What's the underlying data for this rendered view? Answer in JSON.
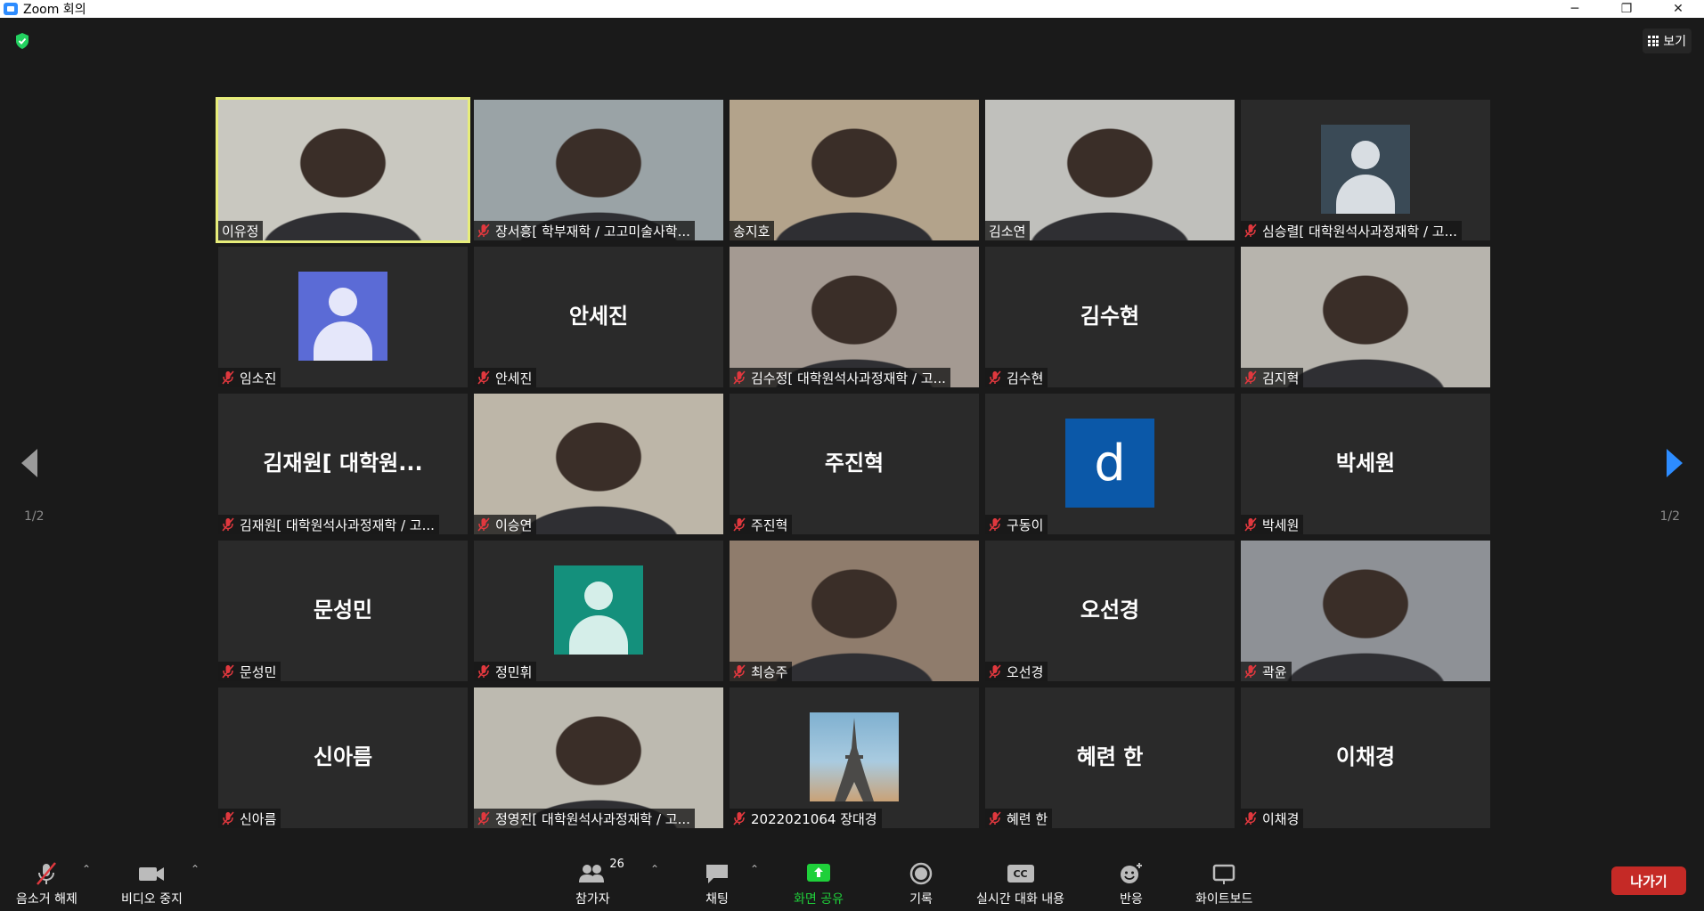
{
  "window": {
    "title": "Zoom 회의",
    "minimize": "─",
    "restore": "❐",
    "close": "✕"
  },
  "header": {
    "view_label": "보기"
  },
  "pagination": {
    "left": "1/2",
    "right": "1/2"
  },
  "colors": {
    "active_border": "#e7ed7a",
    "share_green": "#1fd03a",
    "leave_red": "#c52a26",
    "mute_red": "#e0383e"
  },
  "tiles": [
    {
      "name": "이유정",
      "kind": "video",
      "muted": false,
      "active": true,
      "bg": "#c9c8c0"
    },
    {
      "name": "장서흥[ 학부재학 / 고고미술사학...",
      "kind": "video",
      "muted": true,
      "bg": "#9aa3a6"
    },
    {
      "name": "송지호",
      "kind": "video",
      "muted": false,
      "bg": "#b3a38b"
    },
    {
      "name": "김소연",
      "kind": "video",
      "muted": false,
      "bg": "#c0c0bc"
    },
    {
      "name": "심승렬[ 대학원석사과정재학 / 고...",
      "kind": "avatar",
      "muted": true,
      "avatar_bg": "#3a4a56",
      "avatar_fg": "#d8dde2"
    },
    {
      "name": "임소진",
      "kind": "avatar",
      "muted": true,
      "avatar_bg": "#5b6bd6",
      "avatar_fg": "#e5e7fa"
    },
    {
      "name": "안세진",
      "kind": "text",
      "muted": true,
      "big": "안세진"
    },
    {
      "name": "김수정[ 대학원석사과정재학 / 고...",
      "kind": "video",
      "muted": true,
      "bg": "#a49a92"
    },
    {
      "name": "김수현",
      "kind": "text",
      "muted": true,
      "big": "김수현"
    },
    {
      "name": "김지혁",
      "kind": "video",
      "muted": true,
      "bg": "#b7b4ad"
    },
    {
      "name": "김재원[ 대학원석사과정재학 / 고...",
      "kind": "text",
      "muted": true,
      "big": "김재원[ 대학원..."
    },
    {
      "name": "이승연",
      "kind": "video",
      "muted": true,
      "bg": "#bdb6a8"
    },
    {
      "name": "주진혁",
      "kind": "text",
      "muted": true,
      "big": "주진혁"
    },
    {
      "name": "구동이",
      "kind": "letter",
      "muted": true,
      "letter": "d",
      "avatar_bg": "#0b58a8"
    },
    {
      "name": "박세원",
      "kind": "text",
      "muted": true,
      "big": "박세원"
    },
    {
      "name": "문성민",
      "kind": "text",
      "muted": true,
      "big": "문성민"
    },
    {
      "name": "정민휘",
      "kind": "avatar",
      "muted": true,
      "avatar_bg": "#14907c",
      "avatar_fg": "#d5eee9"
    },
    {
      "name": "최승주",
      "kind": "video",
      "muted": true,
      "bg": "#8f7c6c"
    },
    {
      "name": "오선경",
      "kind": "text",
      "muted": true,
      "big": "오선경"
    },
    {
      "name": "곽윤",
      "kind": "video",
      "muted": true,
      "bg": "#8e9196"
    },
    {
      "name": "신아름",
      "kind": "text",
      "muted": true,
      "big": "신아름"
    },
    {
      "name": "정영진[ 대학원석사과정재학 / 고...",
      "kind": "video",
      "muted": true,
      "bg": "#bdbab0"
    },
    {
      "name": "2022021064 장대경",
      "kind": "photo",
      "muted": true,
      "avatar_bg": "#7fb0d0"
    },
    {
      "name": "혜련 한",
      "kind": "text",
      "muted": true,
      "big": "혜련 한"
    },
    {
      "name": "이채경",
      "kind": "text",
      "muted": true,
      "big": "이채경"
    }
  ],
  "toolbar": {
    "unmute": "음소거 해제",
    "stop_video": "비디오 중지",
    "participants": "참가자",
    "participant_count": "26",
    "chat": "채팅",
    "share": "화면 공유",
    "record": "기록",
    "captions": "실시간 대화 내용",
    "cc": "CC",
    "reactions": "반응",
    "whiteboard": "화이트보드",
    "leave": "나가기"
  }
}
